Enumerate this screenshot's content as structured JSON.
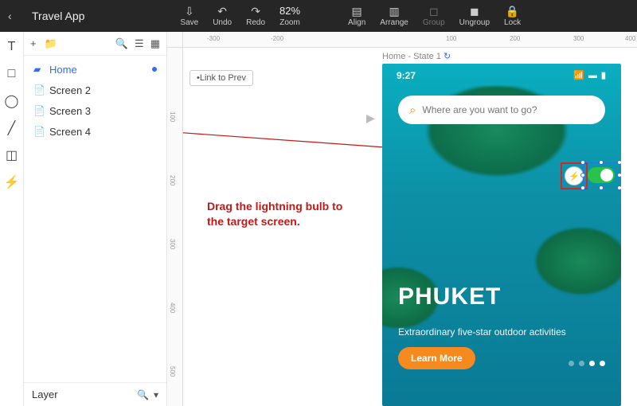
{
  "header": {
    "title": "Travel App",
    "save": "Save",
    "undo": "Undo",
    "redo": "Redo",
    "zoom_value": "82%",
    "zoom_label": "Zoom",
    "align": "Align",
    "arrange": "Arrange",
    "group": "Group",
    "ungroup": "Ungroup",
    "lock": "Lock"
  },
  "panel": {
    "pages": [
      {
        "label": "Home",
        "active": true
      },
      {
        "label": "Screen 2",
        "active": false
      },
      {
        "label": "Screen 3",
        "active": false
      },
      {
        "label": "Screen 4",
        "active": false
      }
    ],
    "footer": "Layer"
  },
  "canvas": {
    "link_prev": "Link to Prev",
    "frame_label": "Home - State 1",
    "ruler_h": [
      "-300",
      "-200",
      "100",
      "200",
      "300",
      "400"
    ],
    "ruler_v": [
      "100",
      "200",
      "300",
      "400",
      "500"
    ]
  },
  "phone": {
    "time": "9:27",
    "search_placeholder": "Where are you want to go?",
    "title": "PHUKET",
    "subtitle": "Extraordinary five-star outdoor activities",
    "cta": "Learn More"
  },
  "annotation": {
    "text": "Drag the lightning bulb to the target screen."
  },
  "colors": {
    "accent": "#2b6cff",
    "danger": "#c21818",
    "cta": "#f68a1e"
  }
}
